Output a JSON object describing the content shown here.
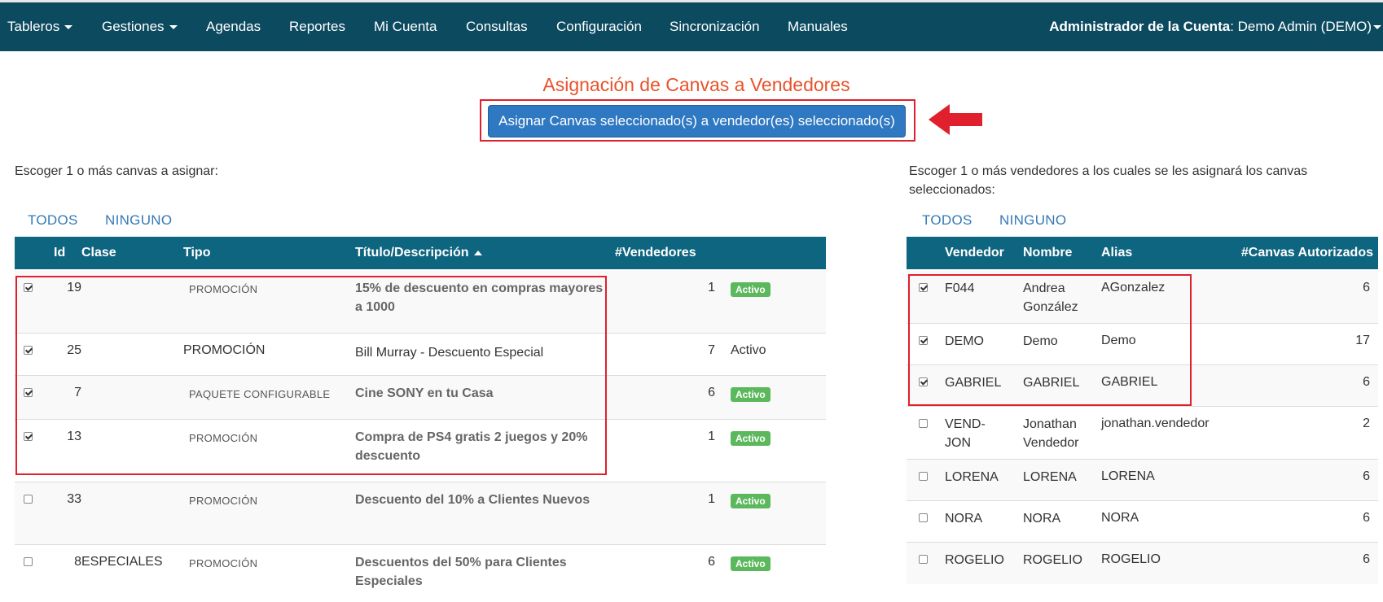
{
  "nav": {
    "items": [
      "Tableros",
      "Gestiones",
      "Agendas",
      "Reportes",
      "Mi Cuenta",
      "Consultas",
      "Configuración",
      "Sincronización",
      "Manuales"
    ],
    "account_label": "Administrador de la Cuenta",
    "account_value": ": Demo Admin (DEMO)"
  },
  "page": {
    "title": "Asignación de Canvas a Vendedores",
    "assign_button": "Asignar Canvas seleccionado(s) a vendedor(es) seleccionado(s)"
  },
  "canvas": {
    "instruction": "Escoger 1 o más canvas a asignar:",
    "all": "TODOS",
    "none": "NINGUNO",
    "headers": [
      "Id",
      "Clase",
      "Tipo",
      "Título/Descripción",
      "#Vendedores"
    ],
    "rows": [
      {
        "checked": true,
        "id": "19",
        "clase": "",
        "tipo": "PROMOCIÓN",
        "titulo": "15% de descuento en compras mayores a 1000",
        "vendedores": "1",
        "estado": "Activo"
      },
      {
        "checked": true,
        "id": "25",
        "clase": "",
        "tipo": "PROMOCIÓN",
        "titulo": "Bill Murray - Descuento Especial",
        "vendedores": "7",
        "estado": "Activo"
      },
      {
        "checked": true,
        "id": "7",
        "clase": "",
        "tipo": "PAQUETE CONFIGURABLE",
        "titulo": "Cine SONY en tu Casa",
        "vendedores": "6",
        "estado": "Activo"
      },
      {
        "checked": true,
        "id": "13",
        "clase": "",
        "tipo": "PROMOCIÓN",
        "titulo": "Compra de PS4 gratis 2 juegos y 20% descuento",
        "vendedores": "1",
        "estado": "Activo"
      },
      {
        "checked": false,
        "id": "33",
        "clase": "",
        "tipo": "PROMOCIÓN",
        "titulo": "Descuento del 10% a Clientes Nuevos",
        "vendedores": "1",
        "estado": "Activo"
      },
      {
        "checked": false,
        "id": "8",
        "clase": "ESPECIALES",
        "tipo": "PROMOCIÓN",
        "titulo": "Descuentos del 50% para Clientes Especiales",
        "vendedores": "6",
        "estado": "Activo"
      }
    ]
  },
  "vendors": {
    "instruction": "Escoger 1 o más vendedores a los cuales se les asignará los canvas seleccionados:",
    "all": "TODOS",
    "none": "NINGUNO",
    "headers": [
      "Vendedor",
      "Nombre",
      "Alias",
      "#Canvas Autorizados"
    ],
    "rows": [
      {
        "checked": true,
        "vendedor": "F044",
        "nombre": "Andrea González",
        "alias": "AGonzalez",
        "canvas": "6"
      },
      {
        "checked": true,
        "vendedor": "DEMO",
        "nombre": "Demo",
        "alias": "Demo",
        "canvas": "17"
      },
      {
        "checked": true,
        "vendedor": "GABRIEL",
        "nombre": "GABRIEL",
        "alias": "GABRIEL",
        "canvas": "6"
      },
      {
        "checked": false,
        "vendedor": "VEND-JON",
        "nombre": "Jonathan Vendedor",
        "alias": "jonathan.vendedor",
        "canvas": "2"
      },
      {
        "checked": false,
        "vendedor": "LORENA",
        "nombre": "LORENA",
        "alias": "LORENA",
        "canvas": "6"
      },
      {
        "checked": false,
        "vendedor": "NORA",
        "nombre": "NORA",
        "alias": "NORA",
        "canvas": "6"
      },
      {
        "checked": false,
        "vendedor": "ROGELIO",
        "nombre": "ROGELIO",
        "alias": "ROGELIO",
        "canvas": "6"
      }
    ]
  },
  "colors": {
    "nav": "#0c4a60",
    "table_header": "#0e6580",
    "title": "#e8532a",
    "button": "#2f78c2",
    "highlight": "#e0202c",
    "badge": "#5cb85c"
  }
}
